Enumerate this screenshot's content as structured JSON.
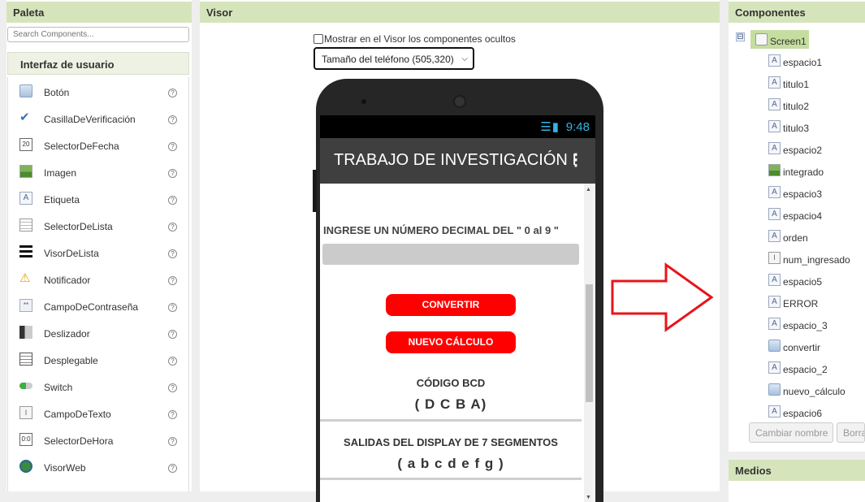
{
  "palette": {
    "title": "Paleta",
    "search_placeholder": "Search Components...",
    "category": "Interfaz de usuario",
    "items": [
      {
        "label": "Botón",
        "icon": "button-icon"
      },
      {
        "label": "CasillaDeVerificación",
        "icon": "checkbox-icon"
      },
      {
        "label": "SelectorDeFecha",
        "icon": "date-picker-icon"
      },
      {
        "label": "Imagen",
        "icon": "image-icon"
      },
      {
        "label": "Etiqueta",
        "icon": "label-icon"
      },
      {
        "label": "SelectorDeLista",
        "icon": "list-picker-icon"
      },
      {
        "label": "VisorDeLista",
        "icon": "list-view-icon"
      },
      {
        "label": "Notificador",
        "icon": "notifier-icon"
      },
      {
        "label": "CampoDeContraseña",
        "icon": "password-icon"
      },
      {
        "label": "Deslizador",
        "icon": "slider-icon"
      },
      {
        "label": "Desplegable",
        "icon": "spinner-icon"
      },
      {
        "label": "Switch",
        "icon": "switch-icon"
      },
      {
        "label": "CampoDeTexto",
        "icon": "textbox-icon"
      },
      {
        "label": "SelectorDeHora",
        "icon": "time-picker-icon"
      },
      {
        "label": "VisorWeb",
        "icon": "web-viewer-icon"
      }
    ],
    "help_glyph": "?"
  },
  "visor": {
    "title": "Visor",
    "show_hidden_label": "Mostrar en el Visor los componentes ocultos",
    "phone_size": "Tamaño del teléfono (505,320)"
  },
  "app": {
    "time": "9:48",
    "title": "TRABAJO DE INVESTIGACIÓN I",
    "menu_glyph": "⋮",
    "prompt": "INGRESE UN NÚMERO DECIMAL DEL \" 0 al 9 \"",
    "convert_button": "CONVERTIR",
    "new_calc_button": "NUEVO CÁLCULO",
    "bcd_title": "CÓDIGO BCD",
    "bcd_bits": "( D C B A)",
    "display_title": "SALIDAS DEL DISPLAY DE 7 SEGMENTOS",
    "display_bits": "( a b c d e f g )"
  },
  "components": {
    "title": "Componentes",
    "root": "Screen1",
    "toggle": "⊟",
    "items": [
      {
        "label": "espacio1",
        "type": "label"
      },
      {
        "label": "titulo1",
        "type": "label"
      },
      {
        "label": "titulo2",
        "type": "label"
      },
      {
        "label": "titulo3",
        "type": "label"
      },
      {
        "label": "espacio2",
        "type": "label"
      },
      {
        "label": "integrado",
        "type": "image"
      },
      {
        "label": "espacio3",
        "type": "label"
      },
      {
        "label": "espacio4",
        "type": "label"
      },
      {
        "label": "orden",
        "type": "label"
      },
      {
        "label": "num_ingresado",
        "type": "textbox"
      },
      {
        "label": "espacio5",
        "type": "label"
      },
      {
        "label": "ERROR",
        "type": "label"
      },
      {
        "label": "espacio_3",
        "type": "label"
      },
      {
        "label": "convertir",
        "type": "button"
      },
      {
        "label": "espacio_2",
        "type": "label"
      },
      {
        "label": "nuevo_cálculo",
        "type": "button"
      },
      {
        "label": "espacio6",
        "type": "label"
      }
    ],
    "rename_button": "Cambiar nombre",
    "delete_button": "Borrar"
  },
  "media": {
    "title": "Medios"
  },
  "colors": {
    "accent_red": "#ff0000",
    "header_green": "#d6e4bc",
    "android_blue": "#33b5e5"
  }
}
